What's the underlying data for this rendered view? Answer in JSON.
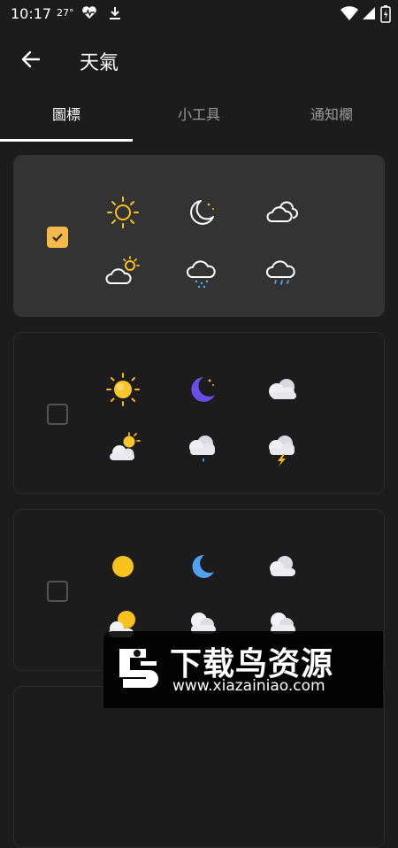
{
  "status_bar": {
    "time": "10:17",
    "temperature": "27°",
    "icons": [
      "heart-monitor-icon",
      "download-icon",
      "wifi-icon",
      "signal-icon",
      "battery-icon"
    ]
  },
  "app_bar": {
    "title": "天氣",
    "back_icon": "arrow-left-icon"
  },
  "tabs": [
    {
      "label": "圖標",
      "active": true
    },
    {
      "label": "小工具",
      "active": false
    },
    {
      "label": "通知欄",
      "active": false
    }
  ],
  "icon_sets": [
    {
      "selected": true,
      "style": "outline",
      "icons": [
        "sun-icon",
        "moon-stars-icon",
        "cloudy-icon",
        "partly-cloudy-icon",
        "rain-cloud-icon",
        "showers-cloud-icon"
      ]
    },
    {
      "selected": false,
      "style": "3d",
      "icons": [
        "sun-icon",
        "moon-icon",
        "cloud-icon",
        "partly-cloudy-icon",
        "rain-cloud-icon",
        "thunderstorm-icon"
      ]
    },
    {
      "selected": false,
      "style": "flat",
      "icons": [
        "sun-icon",
        "moon-icon",
        "cloud-icon",
        "partly-cloudy-icon",
        "cloud-icon",
        "cloud-icon"
      ]
    }
  ],
  "watermark": {
    "name": "下载鸟资源",
    "url": "www.xiazainiao.com"
  },
  "colors": {
    "background": "#1c1c1c",
    "card_selected": "#333333",
    "checkbox_accent": "#f5b94a",
    "sun": "#f7c21c",
    "moon_3d": "#6a4de8",
    "moon_flat": "#4ea3f0"
  }
}
